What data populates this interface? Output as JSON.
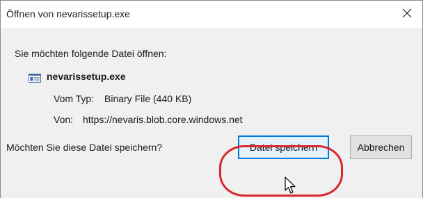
{
  "dialog": {
    "title": "Öffnen von nevarissetup.exe",
    "prompt": "Sie möchten folgende Datei öffnen:",
    "file": {
      "name": "nevarissetup.exe",
      "icon": "application-window-icon",
      "type_label": "Vom Typ:",
      "type_value": "Binary File (440 KB)",
      "from_label": "Von:",
      "from_value": "https://nevaris.blob.core.windows.net"
    },
    "question": "Möchten Sie diese Datei speichern?",
    "buttons": {
      "save_label": "Datei speichern",
      "cancel_label": "Abbrechen"
    }
  },
  "colors": {
    "accent": "#0078d7",
    "highlight": "#d9272e",
    "body_background": "#f0f0f0"
  }
}
